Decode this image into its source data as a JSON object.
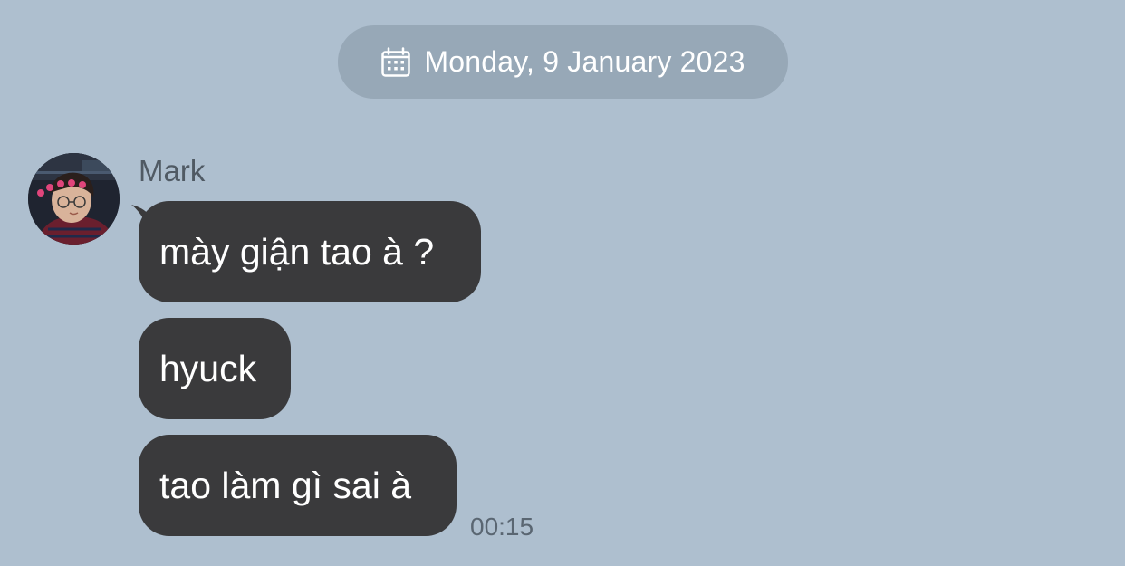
{
  "date_divider": {
    "icon": "calendar-icon",
    "label": "Monday, 9 January 2023"
  },
  "sender": {
    "name": "Mark",
    "avatar_icon": "profile-photo"
  },
  "messages": [
    {
      "text": "mày giận tao à ?"
    },
    {
      "text": "hyuck"
    },
    {
      "text": "tao làm gì sai à"
    }
  ],
  "last_message_time": "00:15",
  "colors": {
    "background": "#aebfcf",
    "date_pill": "#97a8b7",
    "bubble": "#3a3a3c",
    "bubble_text": "#ffffff",
    "secondary_text": "#5a6672"
  }
}
